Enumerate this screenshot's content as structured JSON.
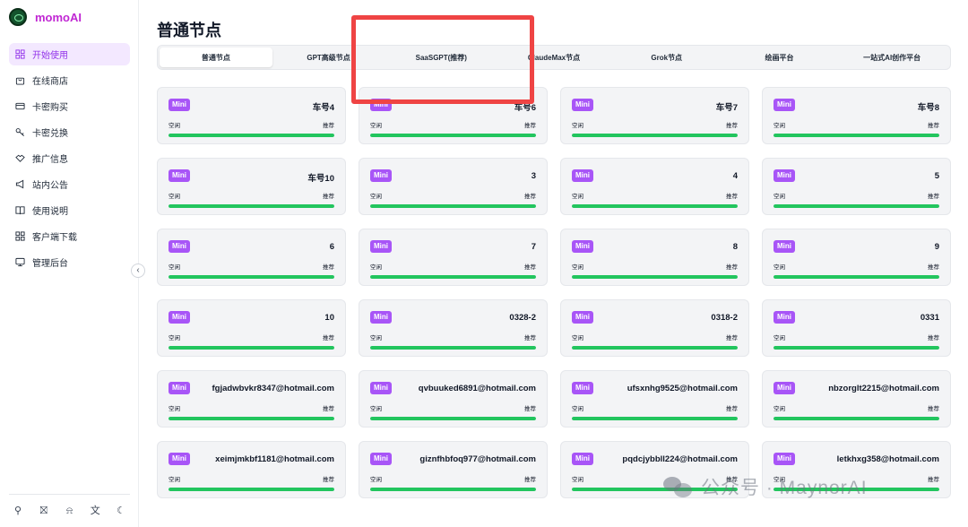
{
  "app": {
    "name": "momoAI"
  },
  "sidebar": {
    "items": [
      {
        "label": "开始使用",
        "icon": "grid-icon",
        "active": true
      },
      {
        "label": "在线商店",
        "icon": "shopping-bag-icon",
        "active": false
      },
      {
        "label": "卡密购买",
        "icon": "credit-card-icon",
        "active": false
      },
      {
        "label": "卡密兑换",
        "icon": "key-icon",
        "active": false
      },
      {
        "label": "推广信息",
        "icon": "handshake-icon",
        "active": false
      },
      {
        "label": "站内公告",
        "icon": "megaphone-icon",
        "active": false
      },
      {
        "label": "使用说明",
        "icon": "book-icon",
        "active": false
      },
      {
        "label": "客户端下载",
        "icon": "apps-icon",
        "active": false
      },
      {
        "label": "管理后台",
        "icon": "monitor-icon",
        "active": false
      }
    ],
    "bottom_icons": [
      "user-icon",
      "gift-icon",
      "bell-icon",
      "translate-icon",
      "moon-icon"
    ]
  },
  "main": {
    "title": "普通节点",
    "tabs": [
      {
        "label": "普通节点",
        "active": true
      },
      {
        "label": "GPT高级节点",
        "active": false
      },
      {
        "label": "SaaSGPT(推荐)",
        "active": false
      },
      {
        "label": "ClaudeMax节点",
        "active": false
      },
      {
        "label": "Grok节点",
        "active": false
      },
      {
        "label": "绘画平台",
        "active": false
      },
      {
        "label": "一站式AI创作平台",
        "active": false
      }
    ],
    "cards": [
      {
        "badge": "Mini",
        "name": "车号4",
        "status": "空闲",
        "tag": "推荐",
        "load": 1.0
      },
      {
        "badge": "Mini",
        "name": "车号6",
        "status": "空闲",
        "tag": "推荐",
        "load": 1.0
      },
      {
        "badge": "Mini",
        "name": "车号7",
        "status": "空闲",
        "tag": "推荐",
        "load": 1.0
      },
      {
        "badge": "Mini",
        "name": "车号8",
        "status": "空闲",
        "tag": "推荐",
        "load": 1.0
      },
      {
        "badge": "Mini",
        "name": "车号10",
        "status": "空闲",
        "tag": "推荐",
        "load": 1.0
      },
      {
        "badge": "Mini",
        "name": "3",
        "status": "空闲",
        "tag": "推荐",
        "load": 1.0
      },
      {
        "badge": "Mini",
        "name": "4",
        "status": "空闲",
        "tag": "推荐",
        "load": 1.0
      },
      {
        "badge": "Mini",
        "name": "5",
        "status": "空闲",
        "tag": "推荐",
        "load": 1.0
      },
      {
        "badge": "Mini",
        "name": "6",
        "status": "空闲",
        "tag": "推荐",
        "load": 1.0
      },
      {
        "badge": "Mini",
        "name": "7",
        "status": "空闲",
        "tag": "推荐",
        "load": 1.0
      },
      {
        "badge": "Mini",
        "name": "8",
        "status": "空闲",
        "tag": "推荐",
        "load": 1.0
      },
      {
        "badge": "Mini",
        "name": "9",
        "status": "空闲",
        "tag": "推荐",
        "load": 1.0
      },
      {
        "badge": "Mini",
        "name": "10",
        "status": "空闲",
        "tag": "推荐",
        "load": 1.0
      },
      {
        "badge": "Mini",
        "name": "0328-2",
        "status": "空闲",
        "tag": "推荐",
        "load": 1.0
      },
      {
        "badge": "Mini",
        "name": "0318-2",
        "status": "空闲",
        "tag": "推荐",
        "load": 1.0
      },
      {
        "badge": "Mini",
        "name": "0331",
        "status": "空闲",
        "tag": "推荐",
        "load": 1.0
      },
      {
        "badge": "Mini",
        "name": "fgjadwbvkr8347@hotmail.com",
        "status": "空闲",
        "tag": "推荐",
        "load": 1.0
      },
      {
        "badge": "Mini",
        "name": "qvbuuked6891@hotmail.com",
        "status": "空闲",
        "tag": "推荐",
        "load": 1.0
      },
      {
        "badge": "Mini",
        "name": "ufsxnhg9525@hotmail.com",
        "status": "空闲",
        "tag": "推荐",
        "load": 1.0
      },
      {
        "badge": "Mini",
        "name": "nbzorglt2215@hotmail.com",
        "status": "空闲",
        "tag": "推荐",
        "load": 1.0
      },
      {
        "badge": "Mini",
        "name": "xeimjmkbf1181@hotmail.com",
        "status": "空闲",
        "tag": "推荐",
        "load": 1.0
      },
      {
        "badge": "Mini",
        "name": "giznfhbfoq977@hotmail.com",
        "status": "空闲",
        "tag": "推荐",
        "load": 1.0
      },
      {
        "badge": "Mini",
        "name": "pqdcjybbll224@hotmail.com",
        "status": "空闲",
        "tag": "推荐",
        "load": 1.0
      },
      {
        "badge": "Mini",
        "name": "letkhxg358@hotmail.com",
        "status": "空闲",
        "tag": "推荐",
        "load": 1.0
      }
    ]
  },
  "watermark": {
    "text": "公众号 · MaynorAI"
  },
  "colors": {
    "accent": "#a855f7",
    "bar": "#22c55e",
    "highlight": "#ef4444",
    "brand": "#c026d3"
  }
}
